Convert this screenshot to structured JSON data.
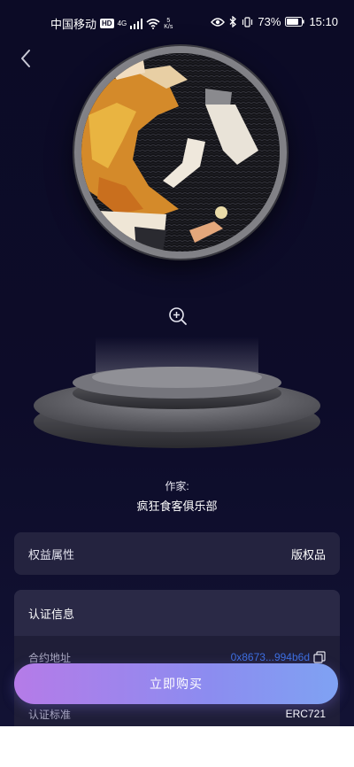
{
  "status_bar": {
    "carrier": "中国移动",
    "hd": "HD",
    "signal_label": "4G",
    "net_speed_value": "5",
    "net_speed_unit": "K/s",
    "battery": "73%",
    "time": "15:10"
  },
  "header": {
    "back_icon": "chevron-left-icon"
  },
  "artwork": {
    "zoom_icon": "zoom-in-icon"
  },
  "author": {
    "label": "作家:",
    "name": "疯狂食客俱乐部"
  },
  "rights": {
    "label": "权益属性",
    "value": "版权品"
  },
  "certification": {
    "title": "认证信息",
    "contract_label": "合约地址",
    "contract_value": "0x8673...994b6d",
    "standard_label": "认证标准",
    "standard_value": "ERC721"
  },
  "actions": {
    "buy_label": "立即购买"
  },
  "colors": {
    "background": "#0c0b26",
    "card": "#24233f",
    "link": "#3d6fe0",
    "button_start": "#b57be8",
    "button_end": "#7fa2f3"
  }
}
